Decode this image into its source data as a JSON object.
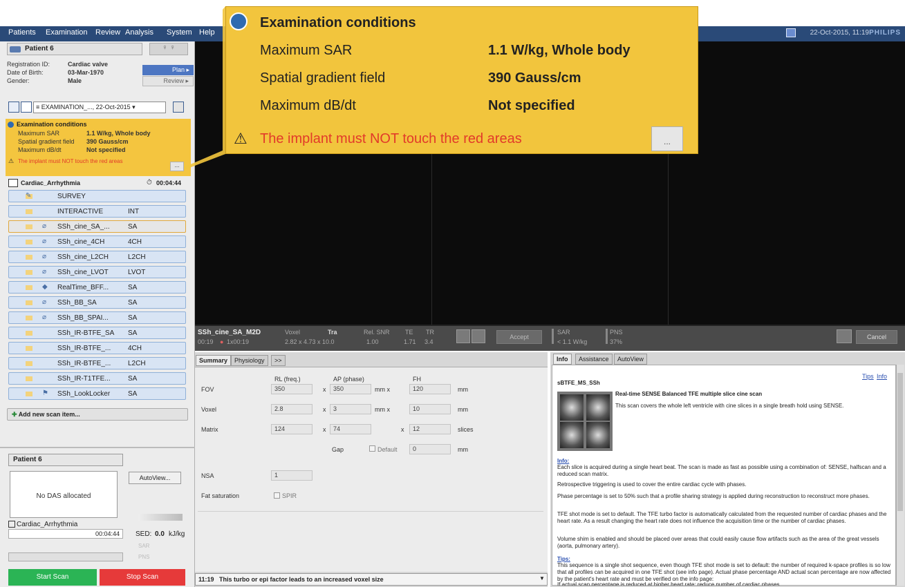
{
  "menu": {
    "items": [
      "Patients",
      "Examination",
      "Review",
      "Analysis",
      "System",
      "Help"
    ]
  },
  "header": {
    "datetime": "22-Oct-2015, 11:19",
    "brand": "PHILIPS"
  },
  "patient": {
    "name": "Patient 6",
    "reg_label": "Registration ID:",
    "reg_value": "Cardiac valve",
    "dob_label": "Date of Birth:",
    "dob_value": "03-Mar-1970",
    "gender_label": "Gender:",
    "gender_value": "Male",
    "plan_label": "Plan",
    "review_label": "Review"
  },
  "exam": {
    "selected": "EXAMINATION_..., 22-Oct-2015"
  },
  "conditions": {
    "title": "Examination conditions",
    "sar_label": "Maximum SAR",
    "sar_value": "1.1 W/kg, Whole body",
    "grad_label": "Spatial gradient field",
    "grad_value": "390 Gauss/cm",
    "dbdt_label": "Maximum dB/dt",
    "dbdt_value": "Not specified",
    "warning": "The implant must NOT touch the red areas",
    "more": "..."
  },
  "protocol": {
    "name": "Cardiac_Arrhythmia",
    "duration": "00:04:44"
  },
  "scans": [
    {
      "name": "SURVEY",
      "code": ""
    },
    {
      "name": "INTERACTIVE",
      "code": "INT"
    },
    {
      "name": "SSh_cine_SA_...",
      "code": "SA"
    },
    {
      "name": "SSh_cine_4CH",
      "code": "4CH"
    },
    {
      "name": "SSh_cine_L2CH",
      "code": "L2CH"
    },
    {
      "name": "SSh_cine_LVOT",
      "code": "LVOT"
    },
    {
      "name": "RealTime_BFF...",
      "code": "SA"
    },
    {
      "name": "SSh_BB_SA",
      "code": "SA"
    },
    {
      "name": "SSh_BB_SPAI...",
      "code": "SA"
    },
    {
      "name": "SSh_IR-BTFE_SA",
      "code": "SA"
    },
    {
      "name": "SSh_IR-BTFE_...",
      "code": "4CH"
    },
    {
      "name": "SSh_IR-BTFE_...",
      "code": "L2CH"
    },
    {
      "name": "SSh_IR-T1TFE...",
      "code": "SA"
    },
    {
      "name": "SSh_LookLocker",
      "code": "SA"
    }
  ],
  "add_scan": "Add new scan item...",
  "bottom": {
    "patient": "Patient 6",
    "das": "No DAS allocated",
    "autoview": "AutoView...",
    "protocol": "Cardiac_Arrhythmia",
    "time": "00:04:44",
    "sed_label": "SED:",
    "sed_value": "0.0",
    "sed_unit": "kJ/kg",
    "sar": "SAR",
    "pns": "PNS",
    "start": "Start Scan",
    "stop": "Stop Scan"
  },
  "scaninfo": {
    "name": "SSh_cine_SA_M2D",
    "time": "00:19",
    "dyn": "1x00:19",
    "voxel_label": "Voxel",
    "voxel_value": "2.82 x 4.73 x 10.0",
    "ori": "Tra",
    "snr_label": "Rel. SNR",
    "snr_value": "1.00",
    "te_label": "TE",
    "te_value": "1.71",
    "tr_label": "TR",
    "tr_value": "3.4",
    "accept": "Accept",
    "sar_label": "SAR",
    "sar_value": "< 1.1  W/kg",
    "pns_label": "PNS",
    "pns_value": "37%",
    "cancel": "Cancel"
  },
  "params": {
    "tabs": [
      "Summary",
      "Physiology",
      ">>"
    ],
    "col1": "RL (freq.)",
    "col2": "AP (phase)",
    "col3": "FH",
    "fov_label": "FOV",
    "fov": [
      "350",
      "350",
      "120"
    ],
    "fov_unit1": "mm  x",
    "fov_unit2": "mm",
    "voxel_label": "Voxel",
    "voxel": [
      "2.8",
      "3",
      "10"
    ],
    "vox_unit1": "mm  x",
    "vox_unit2": "mm",
    "matrix_label": "Matrix",
    "matrix": [
      "124",
      "74",
      "12"
    ],
    "matrix_unit": "slices",
    "gap_label": "Gap",
    "gap_default": "Default",
    "gap_value": "0",
    "gap_unit": "mm",
    "nsa_label": "NSA",
    "nsa_value": "1",
    "fat_label": "Fat saturation",
    "fat_value": "SPIR",
    "x": "x"
  },
  "message": {
    "time": "11:19",
    "text": "This turbo or epi factor leads to an increased voxel size"
  },
  "info": {
    "tabs": [
      "Info",
      "Assistance",
      "AutoView"
    ],
    "tips_link": "Tips",
    "info_link": "Info",
    "seq_name": "sBTFE_MS_SSh",
    "headline": "Real-time SENSE Balanced TFE multiple slice cine scan",
    "summary": "This scan covers the whole left ventricle with cine slices in a single breath hold using SENSE.",
    "info_head": "Info:",
    "p1": "Each slice is acquired during a single heart beat. The scan is made as fast as possible using a combination of: SENSE, halfscan and a reduced scan matrix.",
    "p2": "Retrospective triggering is used to cover the entire cardiac cycle with phases.",
    "p3": "Phase percentage is set to 50% such that a profile sharing strategy is applied during reconstruction to reconstruct more phases.",
    "p4": "TFE shot mode is set to default. The TFE turbo factor is automatically calculated from the requested number of cardiac phases and the heart rate. As a result changing the heart rate does not influence the acquisition time or the number of cardiac phases.",
    "p5": "Volume shim is enabled and should be placed over areas that could easily cause flow artifacts such as the area of the great vessels (aorta, pulmonary artery).",
    "tips_head": "Tips:",
    "p6": "This sequence is a single shot sequence, even though TFE shot mode is set to default: the number of required k-space profiles is so low that all profiles can be acquired in one TFE shot (see info page). Actual phase percentage AND actual scan percentage are now affected by the patient's heart rate and must be verified on the info page:",
    "p7": "If actual scan percentage is reduced at higher heart rate: reduce number of cardiac phases"
  },
  "colors": {
    "accent": "#f2c53d",
    "nav": "#2a4a78",
    "start": "#2bb455",
    "stop": "#e63a3a",
    "warning": "#e23a2a"
  }
}
